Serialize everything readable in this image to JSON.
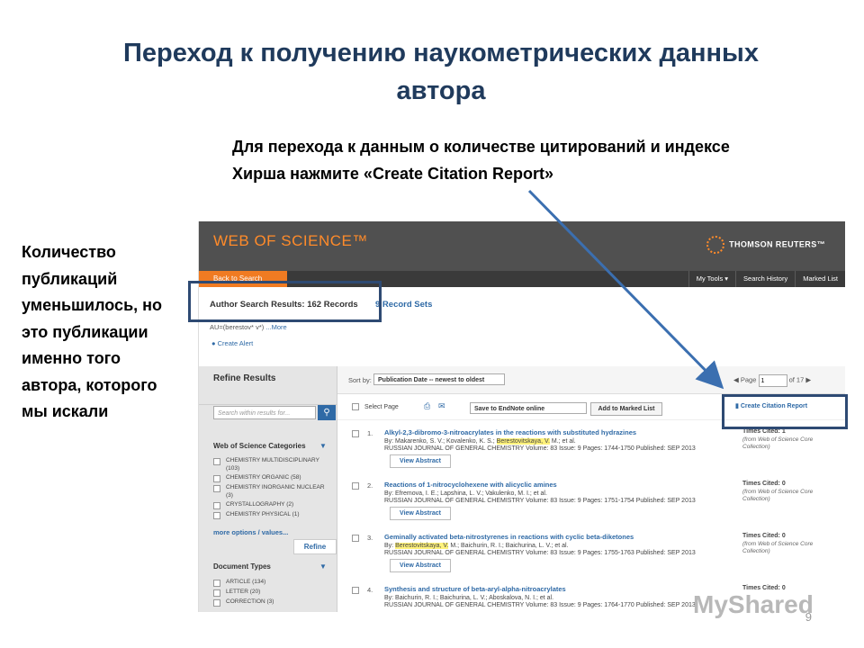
{
  "slide": {
    "title_line1": "Переход к получению наукометрических данных",
    "title_line2": "автора",
    "instruction_line1": "Для перехода к данным о количестве цитирований и индексе",
    "instruction_line2": "Хирша нажмите «Create Citation Report»",
    "left_note": [
      "Количество",
      "публикаций",
      "уменьшилось, но",
      "это публикации",
      "именно того",
      "автора, которого",
      "мы искали"
    ],
    "page_number": "9",
    "watermark": "MyShared",
    "frame_color": "#2e4a73"
  },
  "wos": {
    "logo": "WEB OF SCIENCE™",
    "publisher": "THOMSON REUTERS™",
    "back_label": "Back to Search",
    "nav": [
      "My Tools ▾",
      "Search History",
      "Marked List"
    ],
    "results_title": "Author Search Results: 162 Records",
    "record_sets": "9 Record Sets",
    "query_prefix": "AU=(berestov* v*)",
    "query_more": "...More",
    "create_alert": "Create Alert",
    "refine_title": "Refine Results",
    "search_placeholder": "Search within results for...",
    "categories_title": "Web of Science Categories",
    "categories": [
      "CHEMISTRY MULTIDISCIPLINARY (103)",
      "CHEMISTRY ORGANIC (58)",
      "CHEMISTRY INORGANIC NUCLEAR (3)",
      "CRYSTALLOGRAPHY (2)",
      "CHEMISTRY PHYSICAL (1)"
    ],
    "more_options": "more options / values...",
    "refine_btn": "Refine",
    "doctypes_title": "Document Types",
    "doctypes": [
      "ARTICLE (134)",
      "LETTER (20)",
      "CORRECTION (3)"
    ],
    "sort_label": "Sort by:",
    "sort_value": "Publication Date -- newest to oldest",
    "page_label": "Page",
    "page_value": "1",
    "page_of": "of 17",
    "select_page": "Select Page",
    "endnote": "Save to EndNote online",
    "add_marked": "Add to Marked List",
    "citation_report": "Create Citation Report",
    "view_abstract": "View Abstract",
    "times_cited_src": "(from Web of Science Core Collection)",
    "records": [
      {
        "num": "1.",
        "title": "Alkyl-2,3-dibromo-3-nitroacrylates in the reactions with substituted hydrazines",
        "authors_a": "By: Makarenko, S. V.; Kovalenko, K. S.;",
        "authors_hl": "Berestovitskaya, V.",
        "authors_b": "M.; et al.",
        "journal": "RUSSIAN JOURNAL OF GENERAL CHEMISTRY  Volume: 83  Issue: 9  Pages: 1744-1750  Published: SEP 2013",
        "cited": "Times Cited: 1"
      },
      {
        "num": "2.",
        "title": "Reactions of 1-nitrocyclohexene with alicyclic amines",
        "authors_a": "By: Efremova, I. E.; Lapshina, L. V.; Vakulenko, M. I.; et al.",
        "authors_hl": "",
        "authors_b": "",
        "journal": "RUSSIAN JOURNAL OF GENERAL CHEMISTRY  Volume: 83  Issue: 9  Pages: 1751-1754  Published: SEP 2013",
        "cited": "Times Cited: 0"
      },
      {
        "num": "3.",
        "title": "Geminally activated beta-nitrostyrenes in reactions with cyclic beta-diketones",
        "authors_a": "By:",
        "authors_hl": "Berestovitskaya, V.",
        "authors_b": "M.; Baichurin, R. I.; Baichurina, L. V.; et al.",
        "journal": "RUSSIAN JOURNAL OF GENERAL CHEMISTRY  Volume: 83  Issue: 9  Pages: 1755-1763  Published: SEP 2013",
        "cited": "Times Cited: 0"
      },
      {
        "num": "4.",
        "title": "Synthesis and structure of beta-aryl-alpha-nitroacrylates",
        "authors_a": "By: Baichurin, R. I.; Baichurina, L. V.; Aboskalova, N. I.; et al.",
        "authors_hl": "",
        "authors_b": "",
        "journal": "RUSSIAN JOURNAL OF GENERAL CHEMISTRY  Volume: 83  Issue: 9  Pages: 1764-1770  Published: SEP 2013",
        "cited": "Times Cited: 0"
      }
    ]
  }
}
